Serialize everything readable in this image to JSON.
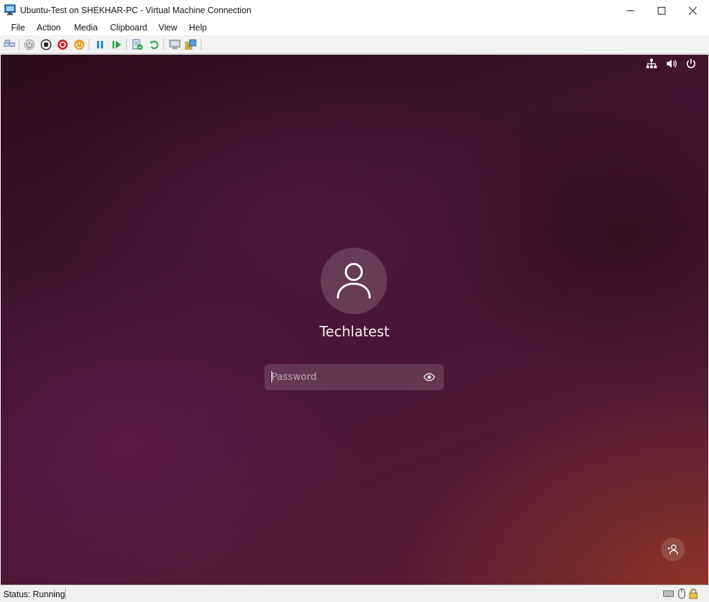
{
  "window": {
    "title": "Ubuntu-Test on SHEKHAR-PC - Virtual Machine Connection",
    "app_icon": "vm-connection-icon",
    "controls": [
      "minimize-icon",
      "maximize-icon",
      "close-icon"
    ]
  },
  "menu": {
    "items": [
      "File",
      "Action",
      "Media",
      "Clipboard",
      "View",
      "Help"
    ]
  },
  "toolbar": {
    "buttons": [
      "ctrl-alt-del-icon",
      "start-icon",
      "turn-off-icon",
      "shut-down-icon",
      "save-state-icon",
      "pause-icon",
      "resume-icon",
      "checkpoint-icon",
      "revert-icon",
      "enhanced-session-icon",
      "share-icon"
    ]
  },
  "vm": {
    "top_right_icons": [
      "network-icon",
      "volume-icon",
      "power-icon"
    ],
    "user": {
      "name": "Techlatest",
      "avatar_icon": "user-avatar-icon"
    },
    "password": {
      "placeholder": "Password",
      "value": "",
      "reveal_icon": "eye-icon"
    },
    "switch_user_icon": "switch-user-icon",
    "colors": {
      "background_dark": "#2a0c1c",
      "background_mid": "#4a1736",
      "background_warm": "#963728"
    }
  },
  "status": {
    "text": "Status: Running",
    "icons": [
      "keyboard-icon",
      "mouse-icon",
      "lock-icon"
    ]
  }
}
